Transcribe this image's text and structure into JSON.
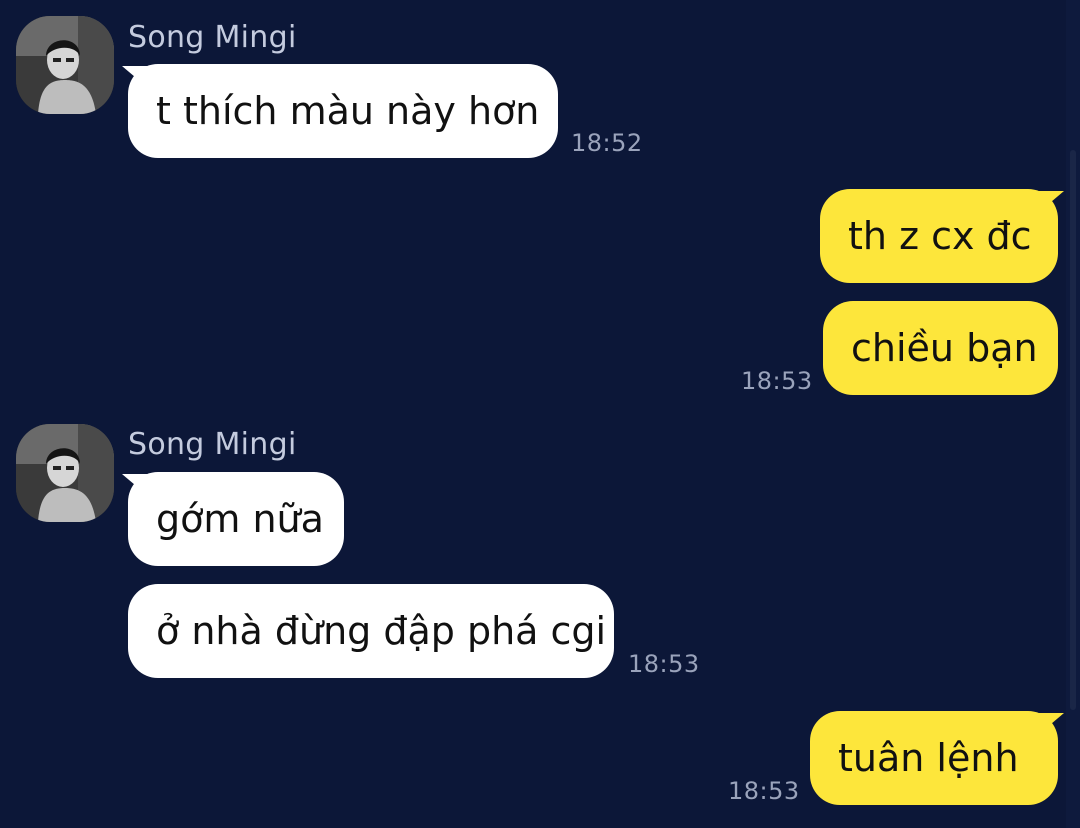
{
  "chat": {
    "colors": {
      "background": "#0c1738",
      "incoming_bubble": "#ffffff",
      "outgoing_bubble": "#fde63b",
      "sender_name": "#c4cbde",
      "timestamp": "#9aa3bb"
    },
    "groups": [
      {
        "side": "incoming",
        "sender": "Song Mingi",
        "avatar_icon": "profile-photo-icon",
        "messages": [
          {
            "text": "t thích màu này hơn",
            "time": "18:52"
          }
        ]
      },
      {
        "side": "outgoing",
        "messages": [
          {
            "text": "th z cx đc"
          },
          {
            "text": "chiều bạn",
            "time": "18:53"
          }
        ]
      },
      {
        "side": "incoming",
        "sender": "Song Mingi",
        "avatar_icon": "profile-photo-icon",
        "messages": [
          {
            "text": "gớm nữa"
          },
          {
            "text": "ở nhà đừng đập phá cgi",
            "time": "18:53"
          }
        ]
      },
      {
        "side": "outgoing",
        "messages": [
          {
            "text": "tuân lệnh",
            "time": "18:53"
          }
        ]
      }
    ]
  }
}
